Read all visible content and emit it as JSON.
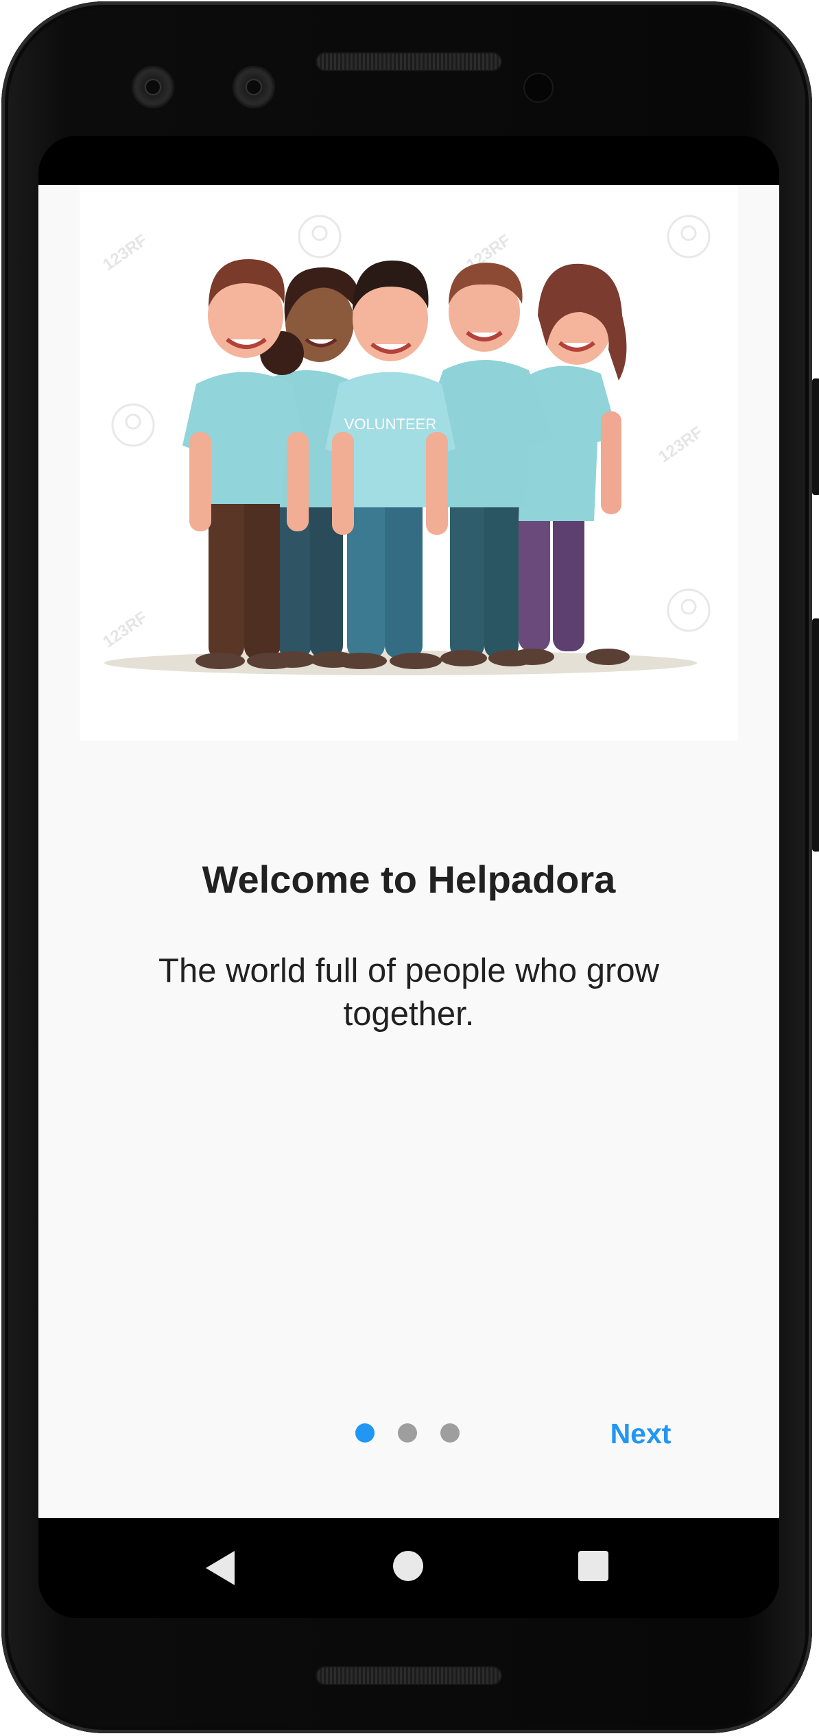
{
  "onboarding": {
    "hero_alt": "Group of volunteers",
    "shirt_text": "VOLUNTEER",
    "watermark": "123RF",
    "title": "Welcome to Helpadora",
    "subtitle": "The world full of people who grow together.",
    "page_indicator": {
      "total": 3,
      "active_index": 0
    },
    "next_label": "Next"
  },
  "colors": {
    "accent": "#2196f3",
    "inactive_dot": "#9e9e9e",
    "background": "#f9f9f9",
    "text": "#212121"
  },
  "navigation_bar": {
    "icons": [
      "back-icon",
      "home-icon",
      "recents-icon"
    ]
  }
}
